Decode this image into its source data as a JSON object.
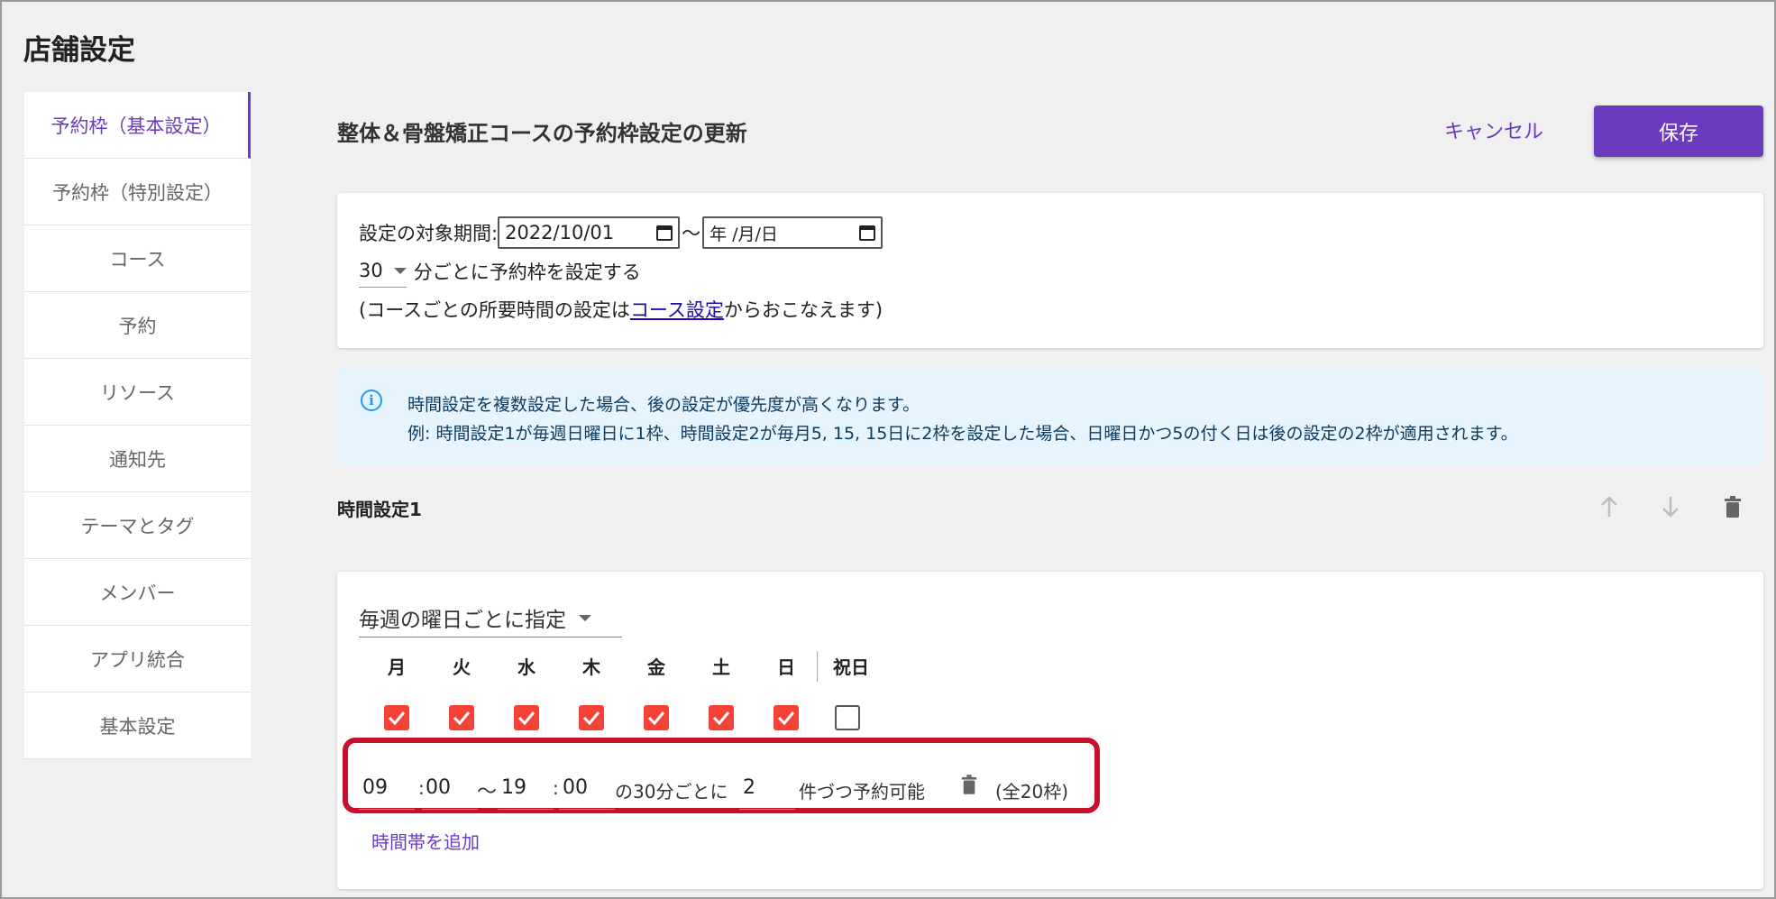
{
  "page_title": "店舗設定",
  "sidebar": {
    "items": [
      {
        "label": "予約枠（基本設定）",
        "active": true
      },
      {
        "label": "予約枠（特別設定）",
        "active": false
      },
      {
        "label": "コース",
        "active": false
      },
      {
        "label": "予約",
        "active": false
      },
      {
        "label": "リソース",
        "active": false
      },
      {
        "label": "通知先",
        "active": false
      },
      {
        "label": "テーマとタグ",
        "active": false
      },
      {
        "label": "メンバー",
        "active": false
      },
      {
        "label": "アプリ統合",
        "active": false
      },
      {
        "label": "基本設定",
        "active": false
      }
    ]
  },
  "header": {
    "title": "整体＆骨盤矯正コースの予約枠設定の更新",
    "cancel_label": "キャンセル",
    "save_label": "保存"
  },
  "period": {
    "label": "設定の対象期間:",
    "start_date": "2022/10/01",
    "separator": "〜",
    "end_placeholder": "年 /月/日",
    "interval_value": "30",
    "interval_suffix": "分ごとに予約枠を設定する",
    "note_prefix": "(コースごとの所要時間の設定は",
    "note_link": "コース設定",
    "note_suffix": "からおこなえます)"
  },
  "info": {
    "line1": "時間設定を複数設定した場合、後の設定が優先度が高くなります。",
    "line2": "例: 時間設定1が毎週日曜日に1枠、時間設定2が毎月5, 15, 15日に2枠を設定した場合、日曜日かつ5の付く日は後の設定の2枠が適用されます。"
  },
  "time_setting": {
    "title": "時間設定1",
    "mode": "毎週の曜日ごとに指定",
    "days": [
      {
        "label": "月",
        "checked": true
      },
      {
        "label": "火",
        "checked": true
      },
      {
        "label": "水",
        "checked": true
      },
      {
        "label": "木",
        "checked": true
      },
      {
        "label": "金",
        "checked": true
      },
      {
        "label": "土",
        "checked": true
      },
      {
        "label": "日",
        "checked": true
      },
      {
        "label": "祝日",
        "checked": false
      }
    ],
    "slot": {
      "start_hour": "09",
      "start_min_sep": ":",
      "start_min": "00",
      "range_sep": "〜",
      "end_hour": "19",
      "end_min_sep": ":",
      "end_min": "00",
      "interval_text": "の30分ごとに",
      "count": "2",
      "count_suffix": "件づつ予約可能",
      "total": "(全20枠)"
    },
    "add_label": "時間帯を追加"
  },
  "colors": {
    "accent": "#6a3bbf",
    "checkbox": "#f44336",
    "highlight": "#c8102e",
    "info_bg": "#e5f4fd"
  }
}
